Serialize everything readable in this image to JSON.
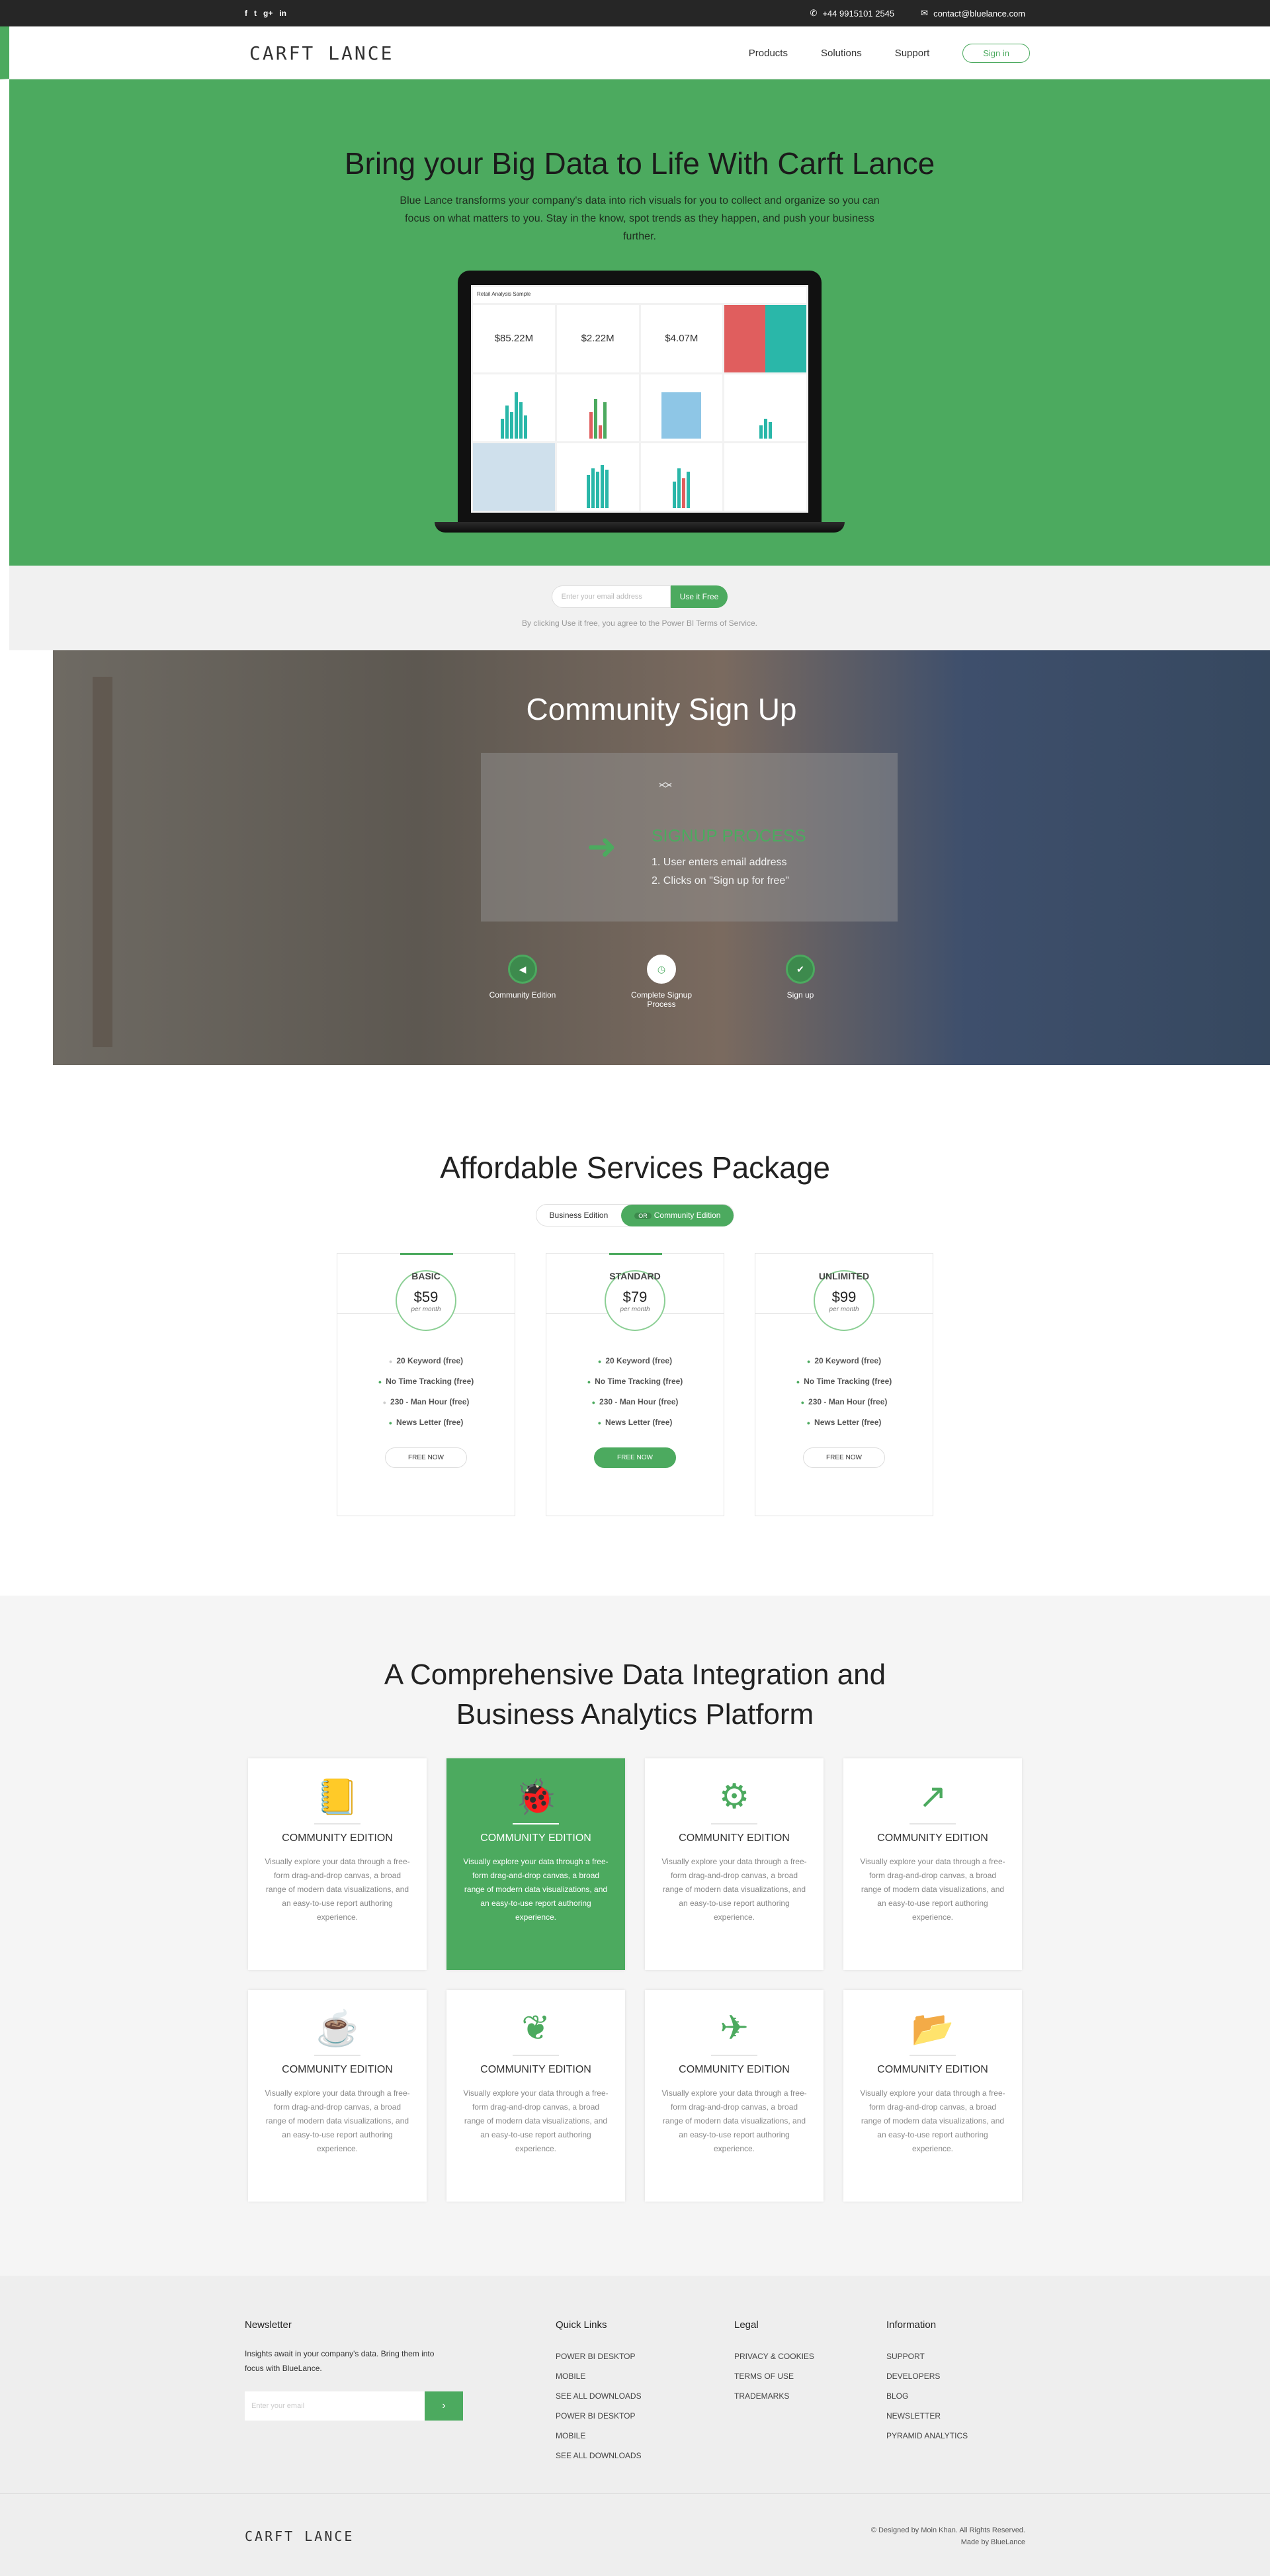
{
  "topbar": {
    "social": [
      "f",
      "t",
      "g+",
      "in"
    ],
    "phone": "+44 9915101 2545",
    "email": "contact@bluelance.com"
  },
  "nav": {
    "logo": "CARFT LANCE",
    "items": [
      "Products",
      "Solutions",
      "Support"
    ],
    "signin": "Sign in"
  },
  "hero": {
    "title": "Bring your Big Data to Life With Carft Lance",
    "text": "Blue Lance transforms your company's data into rich visuals for you to collect and organize so you can focus on what matters to you. Stay in the know, spot trends as they happen, and push your business further.",
    "dashboard_title": "Retail Analysis Sample",
    "kpis": [
      "$85.22M",
      "$2.22M",
      "$4.07M"
    ]
  },
  "signup_strip": {
    "placeholder": "Enter your email address",
    "button": "Use it Free",
    "terms": "By clicking Use it free, you agree to the Power BI Terms of Service."
  },
  "community": {
    "title": "Community Sign Up",
    "process_title": "SIGNUP PROCESS",
    "process_steps": [
      "1. User enters email address",
      "2. Clicks on \"Sign up for free\""
    ],
    "steps": [
      "Community Edition",
      "Complete Signup Process",
      "Sign up"
    ]
  },
  "pricing": {
    "title": "Affordable Services Package",
    "toggle": [
      "Business Edition",
      "Community Edition"
    ],
    "toggle_knob": "OR",
    "plans": [
      {
        "name": "BASIC",
        "price": "$59",
        "period": "per month",
        "features": [
          "20 Keyword (free)",
          "No Time Tracking (free)",
          "230 - Man Hour (free)",
          "News Letter (free)"
        ],
        "button": "FREE NOW"
      },
      {
        "name": "STANDARD",
        "price": "$79",
        "period": "per month",
        "features": [
          "20 Keyword (free)",
          "No Time Tracking (free)",
          "230 - Man Hour (free)",
          "News Letter (free)"
        ],
        "button": "FREE NOW"
      },
      {
        "name": "UNLIMITED",
        "price": "$99",
        "period": "per month",
        "features": [
          "20 Keyword (free)",
          "No Time Tracking (free)",
          "230 - Man Hour (free)",
          "News Letter (free)"
        ],
        "button": "FREE NOW"
      }
    ]
  },
  "features": {
    "title_line1": "A Comprehensive Data Integration and",
    "title_line2": "Business Analytics Platform",
    "cards": [
      {
        "icon": "book-icon",
        "title": "COMMUNITY EDITION",
        "text": "Visually explore your data through a free-form drag-and-drop canvas, a broad range of modern data visualizations, and an easy-to-use report authoring experience."
      },
      {
        "icon": "bug-icon",
        "title": "COMMUNITY EDITION",
        "text": "Visually explore your data through a free-form drag-and-drop canvas, a broad range of modern data visualizations, and an easy-to-use report authoring experience."
      },
      {
        "icon": "gears-icon",
        "title": "COMMUNITY EDITION",
        "text": "Visually explore your data through a free-form drag-and-drop canvas, a broad range of modern data visualizations, and an easy-to-use report authoring experience."
      },
      {
        "icon": "external-link-icon",
        "title": "COMMUNITY EDITION",
        "text": "Visually explore your data through a free-form drag-and-drop canvas, a broad range of modern data visualizations, and an easy-to-use report authoring experience."
      },
      {
        "icon": "coffee-icon",
        "title": "COMMUNITY EDITION",
        "text": "Visually explore your data through a free-form drag-and-drop canvas, a broad range of modern data visualizations, and an easy-to-use report authoring experience."
      },
      {
        "icon": "leaf-icon",
        "title": "COMMUNITY EDITION",
        "text": "Visually explore your data through a free-form drag-and-drop canvas, a broad range of modern data visualizations, and an easy-to-use report authoring experience."
      },
      {
        "icon": "paper-plane-icon",
        "title": "COMMUNITY EDITION",
        "text": "Visually explore your data through a free-form drag-and-drop canvas, a broad range of modern data visualizations, and an easy-to-use report authoring experience."
      },
      {
        "icon": "folder-open-icon",
        "title": "COMMUNITY EDITION",
        "text": "Visually explore your data through a free-form drag-and-drop canvas, a broad range of modern data visualizations, and an easy-to-use report authoring experience."
      }
    ]
  },
  "footer": {
    "newsletter_title": "Newsletter",
    "newsletter_text": "Insights await in your company's data. Bring them into focus with BlueLance.",
    "newsletter_placeholder": "Enter your email",
    "quick_links_title": "Quick Links",
    "quick_links": [
      "POWER BI DESKTOP",
      "MOBILE",
      "SEE ALL DOWNLOADS",
      "POWER BI DESKTOP",
      "MOBILE",
      "SEE ALL DOWNLOADS"
    ],
    "legal_title": "Legal",
    "legal": [
      "PRIVACY & COOKIES",
      "TERMS OF USE",
      "TRADEMARKS"
    ],
    "info_title": "Information",
    "info": [
      "SUPPORT",
      "DEVELOPERS",
      "BLOG",
      "NEWSLETTER",
      "PYRAMID ANALYTICS"
    ],
    "logo": "CARFT LANCE",
    "credit1": "© Designed by Moin Khan. All Rights Reserved.",
    "credit2": "Made by BlueLance"
  },
  "colors": {
    "accent": "#4caa5f",
    "topbar": "#262626"
  }
}
